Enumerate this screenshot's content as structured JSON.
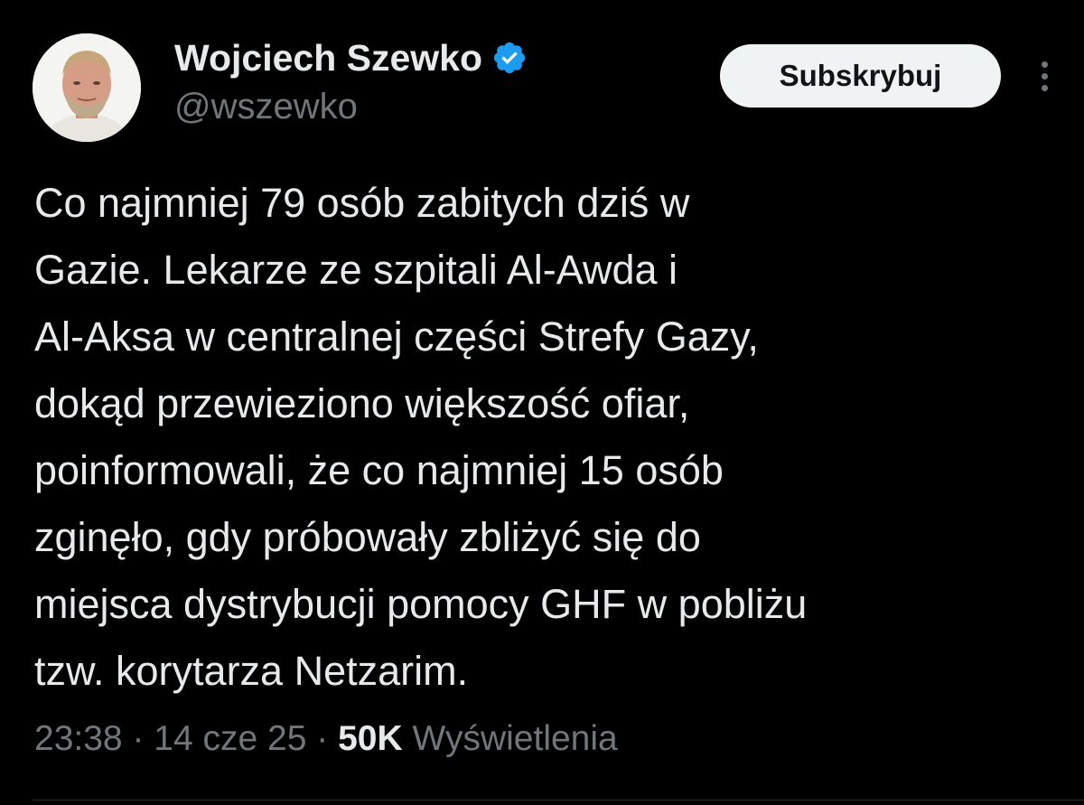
{
  "author": {
    "display_name": "Wojciech Szewko",
    "handle": "@wszewko",
    "verified_icon": "verified-badge-icon",
    "verified_color": "#1d9bf0"
  },
  "actions": {
    "subscribe_label": "Subskrybuj",
    "more_icon": "more-vertical-icon"
  },
  "tweet": {
    "text": "Co najmniej 79 osób zabitych dziś w\nGazie. Lekarze ze szpitali Al-Awda i\nAl-Aksa w centralnej części Strefy Gazy,\ndokąd przewieziono większość ofiar,\npoinformowali, że co najmniej 15 osób\nzginęło, gdy próbowały zbliżyć się do\nmiejsca dystrybucji pomocy GHF w pobliżu\ntzw. korytarza Netzarim."
  },
  "meta": {
    "time": "23:38",
    "separator": "·",
    "date": "14 cze 25",
    "views_count": "50K",
    "views_label": "Wyświetlenia"
  },
  "colors": {
    "background": "#000000",
    "text_primary": "#e7e9ea",
    "text_secondary": "#71767b",
    "button_bg": "#eff3f4"
  }
}
